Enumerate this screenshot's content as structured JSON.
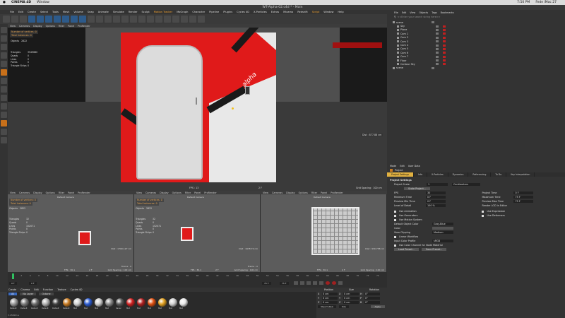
{
  "mac_menu": {
    "apple": "",
    "app": "CINEMA 4D",
    "window": "Window",
    "time": "7:50 PM",
    "user": "Fede iMac 27"
  },
  "window_title": "WT-Alpha-02.c4d * - Main",
  "main_menu": [
    "File",
    "Edit",
    "Create",
    "Select",
    "Tools",
    "Mesh",
    "Volume",
    "Snap",
    "Animate",
    "Simulate",
    "Render",
    "Sculpt",
    "Motion Tracker",
    "MoGraph",
    "Character",
    "Pipeline",
    "Plugins",
    "Cycles 4D",
    "X-Particles",
    "Extras",
    "Mixamo",
    "Redshift",
    "Script",
    "Window",
    "Help"
  ],
  "layout": {
    "label": "Layout:",
    "value": "Startup (User)"
  },
  "viewport_menu": [
    "View",
    "Cameras",
    "Display",
    "Options",
    "Filter",
    "Panel",
    "ProRender"
  ],
  "small_viewport_menu": [
    "View",
    "Cameras",
    "Display",
    "Options",
    "Filter",
    "Panel",
    "ProRender"
  ],
  "main_viewport": {
    "hud_lines": [
      "Number of vertices: 0",
      "Total Instances: 0"
    ],
    "objects_label": "Objects",
    "objects_value": "2822",
    "stats": [
      [
        "Triangles",
        "3549680"
      ],
      [
        "Quads",
        "0"
      ],
      [
        "Lines",
        "0"
      ],
      [
        "Points",
        "0"
      ],
      [
        "Triangle Strips",
        "0"
      ]
    ],
    "fps": "FPS : 13",
    "frame": "2 F",
    "dist": "Dist : 877.88 cm",
    "grid": "Grid Spacing : 100 cm",
    "door_logo": "alpha"
  },
  "small_viewports": [
    {
      "camera": "Default Camera",
      "hud_lines": [
        "Number of vertices: 0",
        "Total Instances: 0"
      ],
      "objects": "2822",
      "stats": [
        [
          "Triangles",
          "32"
        ],
        [
          "Quads",
          "0"
        ],
        [
          "Lines",
          "152071"
        ],
        [
          "Points",
          "0"
        ],
        [
          "Triangle Strips",
          "0"
        ]
      ],
      "dist": "Dist : 1700.127 cm",
      "fps": "FPS : 30.1",
      "frame": "2 F",
      "grid": "Grid Spacing : 100 cm",
      "label": "Frame : 0"
    },
    {
      "camera": "Default Camera",
      "hud_lines": [
        "Number of vertices: 0",
        "Total Instances: 0"
      ],
      "objects": "2822",
      "stats": [
        [
          "Triangles",
          "32"
        ],
        [
          "Quads",
          "0"
        ],
        [
          "Lines",
          "152071"
        ],
        [
          "Points",
          "0"
        ],
        [
          "Triangle Strips",
          "0"
        ]
      ],
      "dist": "Dist : 1978.70 cm",
      "fps": "FPS : 30.1",
      "frame": "2 F",
      "grid": "Grid Spacing : 100 cm",
      "label": "Frame : 0"
    },
    {
      "camera": "Default Camera",
      "hud_lines": [],
      "objects": "",
      "stats": [],
      "dist": "Dist : 930.758 cm",
      "fps": "FPS : 30.1",
      "frame": "2 F",
      "grid": "Grid Spacing : 100 cm",
      "label": ""
    }
  ],
  "object_manager": {
    "menu": [
      "File",
      "Edit",
      "View",
      "Objects",
      "Tags",
      "Bookmarks"
    ],
    "search_placeholder": "<<Enter your search string here>>",
    "items": [
      "scene",
      "Sky",
      "Plane",
      "Cam 1",
      "Cam 2",
      "Cam 3",
      "Cam 4",
      "Cam 5",
      "Cam 6",
      "Cam 7",
      "Floor",
      "Contour Sky",
      "scene"
    ]
  },
  "attribute_manager": {
    "menu": [
      "Mode",
      "Edit",
      "User Data"
    ],
    "title": "Project",
    "tabs": [
      "Project Settings",
      "Info",
      "X-Particles",
      "Dynamics",
      "Referencing",
      "To Do",
      "Key Interpolation"
    ],
    "section": "Project Settings",
    "scale_label": "Project Scale",
    "scale_value": "1",
    "scale_unit": "Centimeters",
    "scale_button": "Scale Project...",
    "left_fields": [
      [
        "FPS",
        "30"
      ],
      [
        "Minimum Time",
        "0 F"
      ],
      [
        "Preview Min Time",
        "0 F"
      ],
      [
        "Level of Detail",
        "100 %"
      ]
    ],
    "right_fields": [
      [
        "Project Time",
        "0 F"
      ],
      [
        "Maximum Time",
        "75 F"
      ],
      [
        "Preview Max Time",
        "75 F"
      ],
      [
        "Render LOD in Editor",
        ""
      ]
    ],
    "checks_left": [
      "Use Animation",
      "Use Generators",
      "Use Motion System"
    ],
    "checks_right": [
      "Use Expression",
      "Use Deformers",
      ""
    ],
    "default_color_label": "Default Object Color",
    "default_color_value": "Gray-Blue",
    "color_label": "Color",
    "view_clipping_label": "View Clipping",
    "view_clipping_value": "Medium",
    "linear_workflow": "Linear Workflow",
    "input_color_label": "Input Color Profile",
    "input_color_value": "sRGB",
    "node_mat": "Use Color Channel for Node Material",
    "buttons": [
      "Load Preset...",
      "Save Preset..."
    ]
  },
  "timeline": {
    "ticks": [
      "0",
      "2",
      "4",
      "6",
      "8",
      "10",
      "12",
      "14",
      "16",
      "18",
      "20",
      "22",
      "24",
      "26",
      "28",
      "30",
      "32",
      "34",
      "36",
      "38",
      "40",
      "42",
      "44",
      "46",
      "48",
      "50",
      "52",
      "54",
      "56",
      "58",
      "60",
      "62",
      "64",
      "66",
      "68",
      "70",
      "72",
      "74"
    ],
    "start": "0 F",
    "end": "75 F",
    "current": "0 F",
    "max": "75 F"
  },
  "material_manager": {
    "menu": [
      "Create",
      "Cinema",
      "Edit",
      "Function",
      "Texture",
      "Cycles 4D"
    ],
    "filter_tabs": [
      "All",
      "No Layer",
      "Octane"
    ],
    "materials": [
      {
        "name": "Default",
        "color": "#9a9a9a"
      },
      {
        "name": "Default",
        "color": "#7a7a7a"
      },
      {
        "name": "Default",
        "color": "#6a6a6a"
      },
      {
        "name": "Default",
        "color": "#b0b0b0"
      },
      {
        "name": "Default",
        "color": "#404040"
      },
      {
        "name": "Default",
        "color": "#c87a20"
      },
      {
        "name": "Mat",
        "color": "#d0d0d0"
      },
      {
        "name": "Mat",
        "color": "#2a5ad0"
      },
      {
        "name": "Mat",
        "color": "#cccccc"
      },
      {
        "name": "Mat",
        "color": "#8a8a8a"
      },
      {
        "name": "Sanec",
        "color": "#5a5a5a"
      },
      {
        "name": "Mat",
        "color": "#d02020"
      },
      {
        "name": "Mat",
        "color": "#b02020"
      },
      {
        "name": "Mat",
        "color": "#e05010"
      },
      {
        "name": "Mat",
        "color": "#e0a020"
      },
      {
        "name": "Mat",
        "color": "#d0d0d0"
      },
      {
        "name": "Mat",
        "color": "#e8e8e8"
      }
    ],
    "status": "Mode 3.4589m s"
  },
  "coords": {
    "headers": [
      "Position",
      "Size",
      "Rotation"
    ],
    "rows": [
      [
        "X",
        "0 cm",
        "X",
        "0 cm",
        "H",
        "0°"
      ],
      [
        "Y",
        "0 cm",
        "Y",
        "0 cm",
        "P",
        "0°"
      ],
      [
        "Z",
        "0 cm",
        "Z",
        "0 cm",
        "B",
        "0°"
      ]
    ],
    "mode": "Object (Rel)",
    "size_mode": "Size",
    "apply": "Apply"
  },
  "colors": {
    "accent": "#e0b040",
    "door_red": "#e01a1a",
    "panel": "#333333",
    "viewport": "#5a5a5a"
  }
}
